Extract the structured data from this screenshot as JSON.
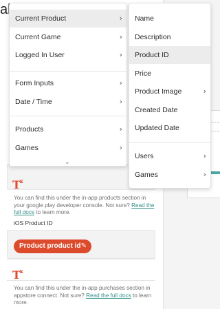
{
  "background": {
    "title_fragment": "al",
    "android_help": {
      "text": "You can find this under the in-app products section in your google play developer console. Not sure? ",
      "link": "Read the full docs",
      "tail": " to learn more."
    },
    "ios_label": "iOS Product ID",
    "pill_label": "Product product id",
    "pill_icon": "pencil-icon",
    "text_icon_glyph": "T",
    "text_icon_mark": "x",
    "ios_help": {
      "text": "You can find this under the in-app purchases section in appstore connect. Not sure? ",
      "link": "Read the full docs",
      "tail": " to learn more."
    },
    "accent_color": "#dd4b2d",
    "link_color": "#2f8f88"
  },
  "left_menu": {
    "items": [
      {
        "label": "Current Product",
        "has_submenu": true,
        "active": true
      },
      {
        "label": "Current Game",
        "has_submenu": true
      },
      {
        "label": "Logged In User",
        "has_submenu": true
      },
      {
        "label": "Form Inputs",
        "has_submenu": true
      },
      {
        "label": "Date / Time",
        "has_submenu": true
      },
      {
        "label": "Products",
        "has_submenu": true
      },
      {
        "label": "Games",
        "has_submenu": true
      }
    ],
    "scroll_icon": "chevron-down-icon"
  },
  "right_menu": {
    "items": [
      {
        "label": "Name"
      },
      {
        "label": "Description"
      },
      {
        "label": "Product ID",
        "active": true
      },
      {
        "label": "Price"
      },
      {
        "label": "Product Image",
        "has_submenu": true
      },
      {
        "label": "Created Date"
      },
      {
        "label": "Updated Date"
      },
      {
        "label": "Users",
        "has_submenu": true
      },
      {
        "label": "Games",
        "has_submenu": true
      }
    ]
  }
}
